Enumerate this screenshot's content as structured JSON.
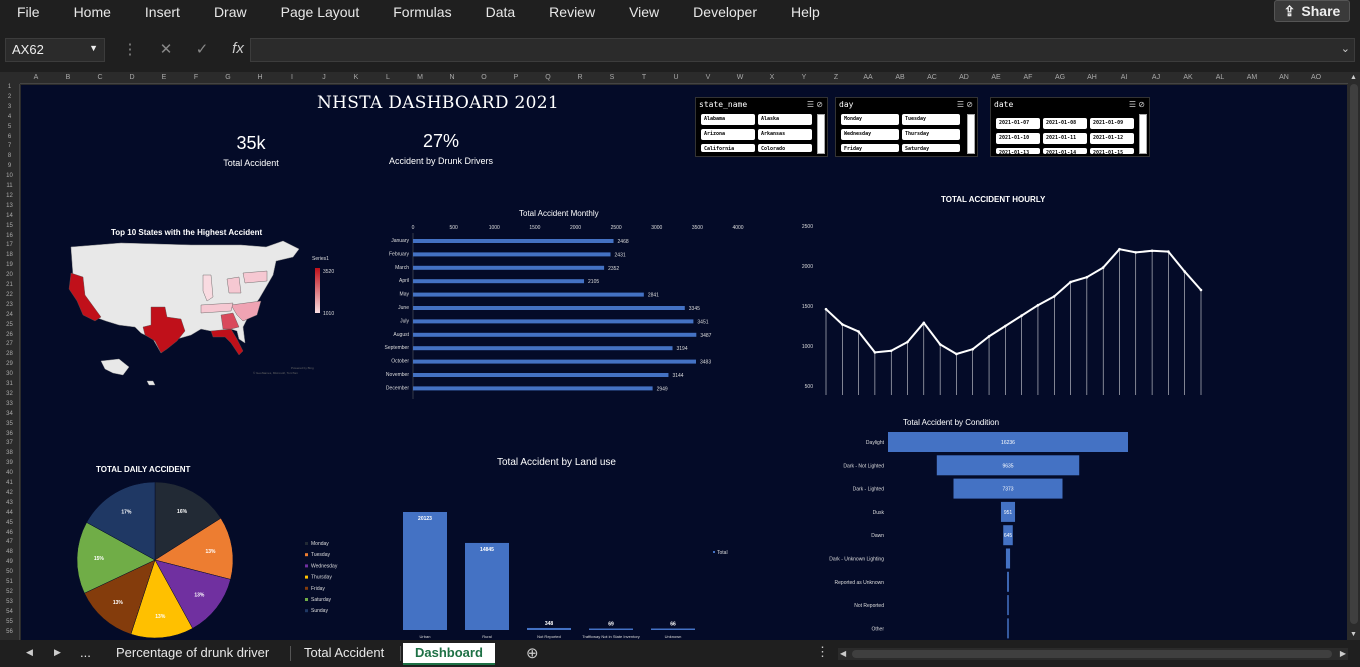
{
  "menu": [
    "File",
    "Home",
    "Insert",
    "Draw",
    "Page Layout",
    "Formulas",
    "Data",
    "Review",
    "View",
    "Developer",
    "Help"
  ],
  "share_label": "Share",
  "name_box": "AX62",
  "fx_label": "fx",
  "columns": [
    "A",
    "B",
    "C",
    "D",
    "E",
    "F",
    "G",
    "H",
    "I",
    "J",
    "K",
    "L",
    "M",
    "N",
    "O",
    "P",
    "Q",
    "R",
    "S",
    "T",
    "U",
    "V",
    "W",
    "X",
    "Y",
    "Z",
    "AA",
    "AB",
    "AC",
    "AD",
    "AE",
    "AF",
    "AG",
    "AH",
    "AI",
    "AJ",
    "AK",
    "AL",
    "AM",
    "AN",
    "AO"
  ],
  "rows": [
    "1",
    "2",
    "3",
    "4",
    "5",
    "6",
    "7",
    "8",
    "9",
    "10",
    "11",
    "12",
    "13",
    "14",
    "15",
    "16",
    "17",
    "18",
    "19",
    "20",
    "21",
    "22",
    "23",
    "24",
    "25",
    "26",
    "27",
    "28",
    "29",
    "30",
    "31",
    "32",
    "33",
    "34",
    "35",
    "36",
    "37",
    "38",
    "39",
    "40",
    "41",
    "42",
    "43",
    "44",
    "45",
    "46",
    "47",
    "48",
    "49",
    "50",
    "51",
    "52",
    "53",
    "54",
    "55",
    "56"
  ],
  "dashboard": {
    "title": "NHSTA DASHBOARD 2021",
    "kpi1_value": "35k",
    "kpi1_label": "Total Accident",
    "kpi2_value": "27%",
    "kpi2_label": "Accident by Drunk Drivers"
  },
  "slicers": [
    {
      "header": "state_name",
      "items": [
        "Alabama",
        "Alaska",
        "Arizona",
        "Arkansas",
        "California",
        "Colorado"
      ]
    },
    {
      "header": "day",
      "items": [
        "Monday",
        "Tuesday",
        "Wednesday",
        "Thursday",
        "Friday",
        "Saturday"
      ]
    },
    {
      "header": "date",
      "items": [
        "2021-01-07",
        "2021-01-08",
        "2021-01-09",
        "2021-01-10",
        "2021-01-11",
        "2021-01-12",
        "2021-01-13",
        "2021-01-14",
        "2021-01-15"
      ]
    }
  ],
  "map": {
    "title": "Top 10 States with the Highest Accident",
    "legend_title": "Series1",
    "legend_max": "3520",
    "legend_min": "1010",
    "credit1": "Powered by Bing",
    "credit2": "© GeoNames, Microsoft, TomTom"
  },
  "chart_data": [
    {
      "type": "bar",
      "title": "Total Accident Monthly",
      "categories": [
        "January",
        "February",
        "March",
        "April",
        "May",
        "June",
        "July",
        "August",
        "September",
        "October",
        "November",
        "December"
      ],
      "values": [
        2468,
        2431,
        2352,
        2105,
        2841,
        3345,
        3451,
        3487,
        3194,
        3483,
        3144,
        2949
      ],
      "xlim": [
        0,
        4000
      ],
      "xticks": [
        "0",
        "500",
        "1000",
        "1500",
        "2000",
        "2500",
        "3000",
        "3500",
        "4000"
      ],
      "color": "#4472c4"
    },
    {
      "type": "line",
      "title": "TOTAL ACCIDENT HOURLY",
      "categories": [
        "00:00 am",
        "01:00 am",
        "02:00 am",
        "03:00 am",
        "04:00 am",
        "05:00 am",
        "06:00 am",
        "07:00 am",
        "08:00 am",
        "09:00 am",
        "10:00 am",
        "11:00 am",
        "12:00 pm",
        "13:00 pm",
        "14:00 pm",
        "15:00 pm",
        "16:00 pm",
        "17:00 pm",
        "18:00 pm",
        "19:00 pm",
        "20:00 pm",
        "21:00 pm",
        "22:00 pm",
        "23:00 pm"
      ],
      "values": [
        1460,
        1270,
        1180,
        920,
        940,
        1050,
        1290,
        1020,
        900,
        960,
        1120,
        1250,
        1380,
        1510,
        1620,
        1800,
        1860,
        1980,
        2210,
        2170,
        2190,
        2180,
        1930,
        1700
      ],
      "ylim": [
        0,
        2500
      ],
      "yticks": [
        "0",
        "500",
        "1000",
        "1500",
        "2000",
        "2500"
      ],
      "color": "#ffffff"
    },
    {
      "type": "pie",
      "title": "TOTAL DAILY ACCIDENT",
      "categories": [
        "Monday",
        "Tuesday",
        "Wednesday",
        "Thursday",
        "Friday",
        "Saturday",
        "Sunday"
      ],
      "values": [
        16,
        13,
        13,
        13,
        13,
        15,
        17
      ],
      "labels": [
        "16%",
        "13%",
        "13%",
        "13%",
        "13%",
        "15%",
        "17%"
      ],
      "colors": [
        "#222a35",
        "#ed7d31",
        "#7030a0",
        "#ffc000",
        "#843c0c",
        "#70ad47",
        "#1f3864"
      ]
    },
    {
      "type": "bar",
      "title": "Total Accident by Land use",
      "categories": [
        "Urban",
        "Rural",
        "Not Reported",
        "Trafficway Not in State Inventory",
        "Unknown"
      ],
      "values": [
        20123,
        14845,
        348,
        69,
        66
      ],
      "legend": "Total",
      "ylim": [
        0,
        20123
      ],
      "color": "#4472c4"
    },
    {
      "type": "bar",
      "title": "Total Accident by Condition",
      "categories": [
        "Daylight",
        "Dark - Not Lighted",
        "Dark - Lighted",
        "Dusk",
        "Dawn",
        "Dark - Unknown Lighting",
        "Reported as Unknown",
        "Not Reported",
        "Other"
      ],
      "values": [
        16236,
        9635,
        7373,
        951,
        645,
        280,
        120,
        80,
        40
      ],
      "labels": [
        "16236",
        "9635",
        "7373",
        "951",
        "645",
        "",
        "",
        "",
        ""
      ],
      "color": "#4472c4"
    }
  ],
  "sheet_tabs": [
    "Percentage of drunk driver",
    "Total Accident",
    "Dashboard"
  ],
  "more_tabs": "..."
}
